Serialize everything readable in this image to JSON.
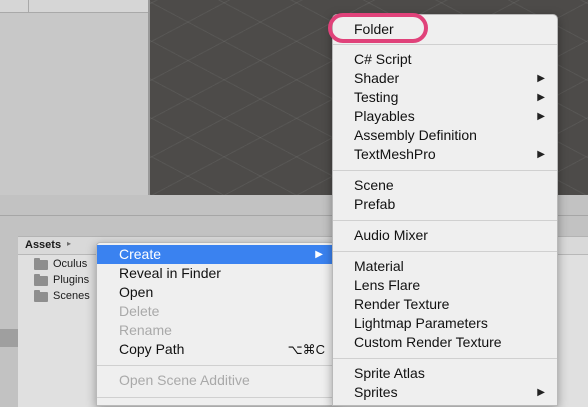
{
  "project_panel": {
    "breadcrumb": "Assets",
    "folders": [
      "Oculus",
      "Plugins",
      "Scenes"
    ]
  },
  "context_menu": {
    "items": [
      {
        "label": "Create",
        "has_submenu": true,
        "highlighted": true,
        "enabled": true
      },
      {
        "label": "Reveal in Finder",
        "enabled": true
      },
      {
        "label": "Open",
        "enabled": true
      },
      {
        "label": "Delete",
        "enabled": false
      },
      {
        "label": "Rename",
        "enabled": false
      },
      {
        "label": "Copy Path",
        "shortcut": "⌥⌘C",
        "enabled": true
      },
      {
        "label": "Open Scene Additive",
        "enabled": false
      }
    ]
  },
  "create_submenu": {
    "items": [
      {
        "label": "Folder",
        "highlighted_ring": true
      },
      {
        "label": "C# Script"
      },
      {
        "label": "Shader",
        "has_submenu": true
      },
      {
        "label": "Testing",
        "has_submenu": true
      },
      {
        "label": "Playables",
        "has_submenu": true
      },
      {
        "label": "Assembly Definition"
      },
      {
        "label": "TextMeshPro",
        "has_submenu": true
      },
      {
        "label": "Scene"
      },
      {
        "label": "Prefab"
      },
      {
        "label": "Audio Mixer"
      },
      {
        "label": "Material"
      },
      {
        "label": "Lens Flare"
      },
      {
        "label": "Render Texture"
      },
      {
        "label": "Lightmap Parameters"
      },
      {
        "label": "Custom Render Texture"
      },
      {
        "label": "Sprite Atlas"
      },
      {
        "label": "Sprites",
        "has_submenu": true
      }
    ]
  },
  "colors": {
    "highlight": "#3a82f0",
    "annotation_ring": "#e0427a",
    "scene_background": "#4d4b49"
  }
}
